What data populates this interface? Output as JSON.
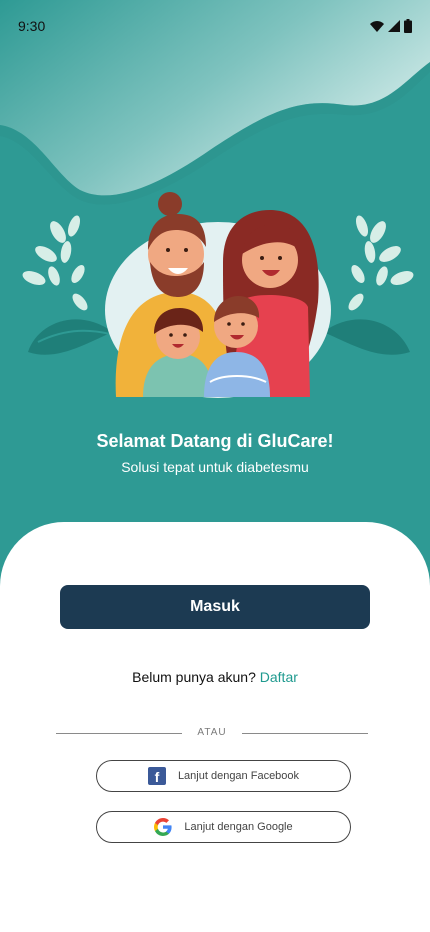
{
  "status_bar": {
    "time": "9:30"
  },
  "welcome": {
    "title": "Selamat Datang di GluCare!",
    "subtitle": "Solusi tepat untuk diabetesmu"
  },
  "auth": {
    "login_label": "Masuk",
    "no_account_text": "Belum punya akun?",
    "register_label": "Daftar",
    "divider_label": "ATAU",
    "facebook_label": "Lanjut dengan Facebook",
    "google_label": "Lanjut dengan Google"
  },
  "colors": {
    "hero_teal": "#2e9a94",
    "primary_button": "#1c3a52",
    "link_accent": "#1f9a8f"
  },
  "icons": [
    "wifi-icon",
    "signal-icon",
    "battery-icon",
    "facebook-icon",
    "google-icon"
  ]
}
